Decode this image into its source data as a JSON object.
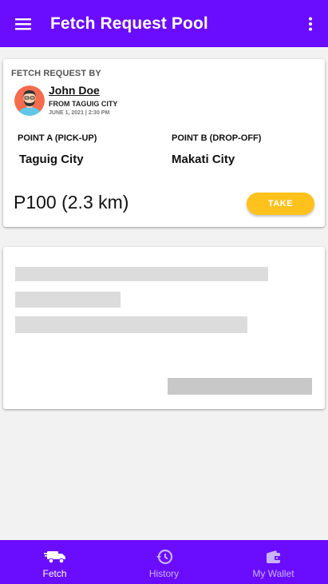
{
  "appbar": {
    "title": "Fetch Request Pool",
    "menu_icon": "hamburger-menu-icon",
    "more_icon": "more-vertical-icon"
  },
  "request": {
    "section_label": "FETCH REQUEST BY",
    "requester_name": "John Doe",
    "requester_from": "FROM TAGUIG CITY",
    "requester_date": "JUNE 1, 2021 | 2:30 PM",
    "point_a_label": "POINT A (PICK-UP)",
    "point_a_value": "Taguig City",
    "point_b_label": "POINT B (DROP-OFF)",
    "point_b_value": "Makati City",
    "fare": "P100 (2.3 km)",
    "take_label": "TAKE"
  },
  "bottom_nav": {
    "items": [
      {
        "label": "Fetch",
        "icon": "truck-icon",
        "active": true
      },
      {
        "label": "History",
        "icon": "history-icon",
        "active": false
      },
      {
        "label": "My Wallet",
        "icon": "wallet-icon",
        "active": false
      }
    ]
  },
  "colors": {
    "primary": "#6a0dff",
    "accent": "#ffc21c",
    "background": "#f2f2f2",
    "skeleton": "#dcdcdc"
  }
}
